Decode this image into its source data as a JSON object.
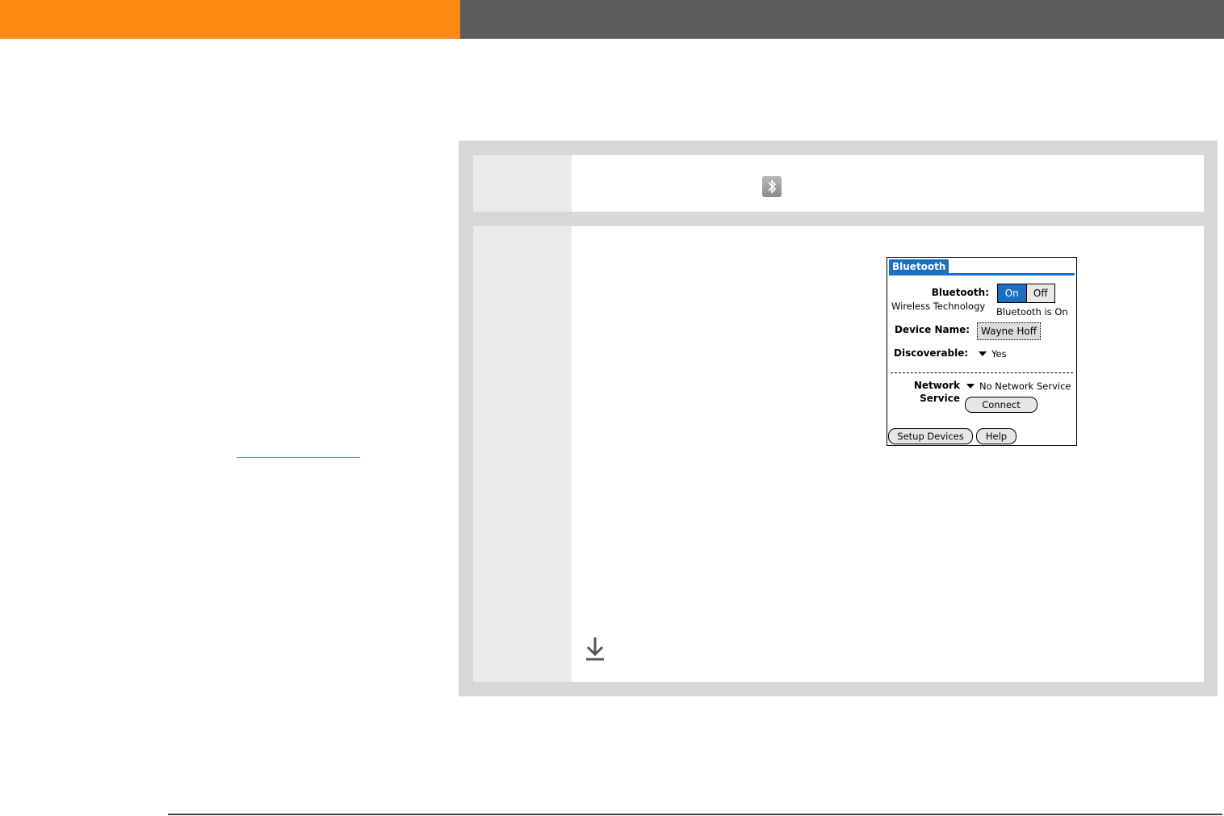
{
  "colors": {
    "header_orange": "#fc8a15",
    "header_gray": "#5c5c5c",
    "panel_gray": "#d7d7d7",
    "step_num_bg": "#eaeaea",
    "link_green": "#2a9a2a",
    "palm_blue": "#1a6fc4",
    "footer_rule": "#444444"
  },
  "palm": {
    "title": "Bluetooth",
    "bluetooth_label": "Bluetooth:",
    "wireless_label": "Wireless Technology",
    "on_label": "On",
    "off_label": "Off",
    "status_text": "Bluetooth is On",
    "device_name_label": "Device Name:",
    "device_name_value": "Wayne Hoff",
    "discoverable_label": "Discoverable:",
    "discoverable_value": "Yes",
    "network_label": "Network",
    "service_label": "Service",
    "network_value": "No Network Service",
    "connect_button": "Connect",
    "setup_button": "Setup Devices",
    "help_button": "Help"
  },
  "icons": {
    "step1_icon": "bluetooth-icon",
    "step2_icon": "down-arrow-icon"
  }
}
